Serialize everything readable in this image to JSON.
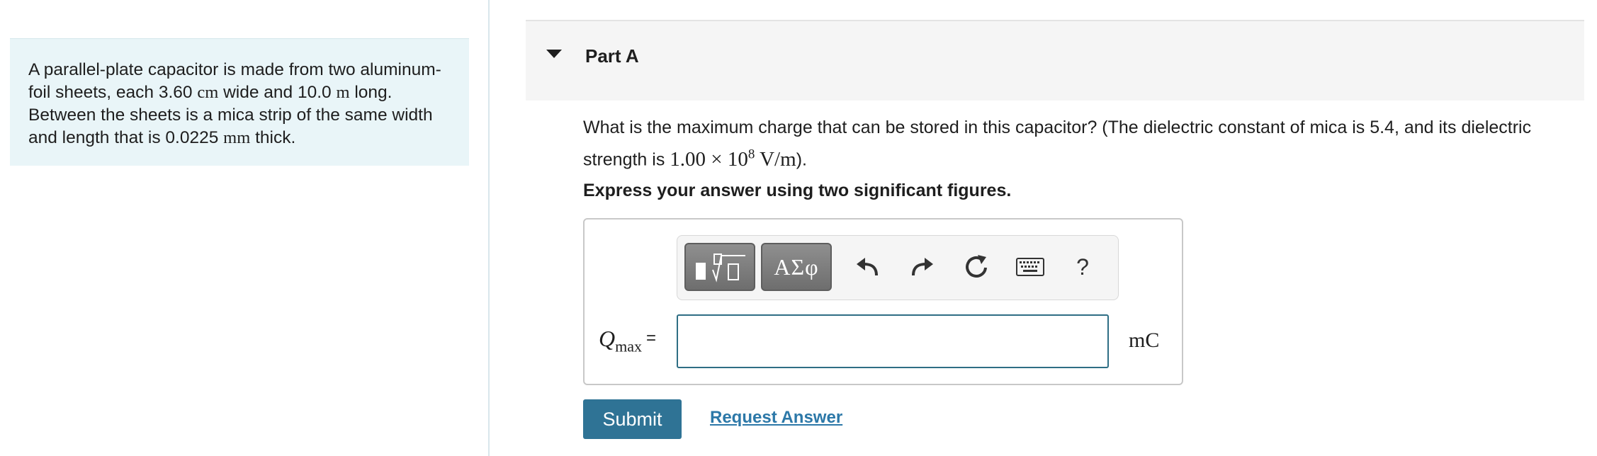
{
  "problem": {
    "segments": [
      {
        "text": "A parallel-plate capacitor is made from two aluminum-foil sheets, each 3.60 "
      },
      {
        "text": "cm",
        "math": true
      },
      {
        "text": " wide and 10.0 "
      },
      {
        "text": "m",
        "math": true
      },
      {
        "text": " long. Between the sheets is a mica strip of the same width and length that is 0.0225 "
      },
      {
        "text": "mm",
        "math": true
      },
      {
        "text": " thick."
      }
    ]
  },
  "part": {
    "title": "Part A"
  },
  "question": {
    "text_before": "What is the maximum charge that can be stored in this capacitor? (The dielectric constant of mica is 5.4, and its dielectric strength is ",
    "math_mantissa": "1.00 × 10",
    "math_exponent": "8",
    "math_unit": " V/m",
    "text_after": ")."
  },
  "instruction": "Express your answer using two significant figures.",
  "toolbar": {
    "templates_icon": "templates-icon",
    "symbols_label": "ΑΣφ",
    "undo_icon": "undo-icon",
    "redo_icon": "redo-icon",
    "reset_icon": "reset-icon",
    "keyboard_icon": "keyboard-icon",
    "help_label": "?"
  },
  "answer": {
    "variable": "Q",
    "subscript": "max",
    "equals": "=",
    "value": "",
    "unit": "mC"
  },
  "actions": {
    "submit_label": "Submit",
    "request_answer_label": "Request Answer"
  },
  "colors": {
    "panel_background": "#e9f5f8",
    "submit_background": "#2f7395",
    "link": "#2c78a8",
    "input_border": "#2e6e84"
  }
}
